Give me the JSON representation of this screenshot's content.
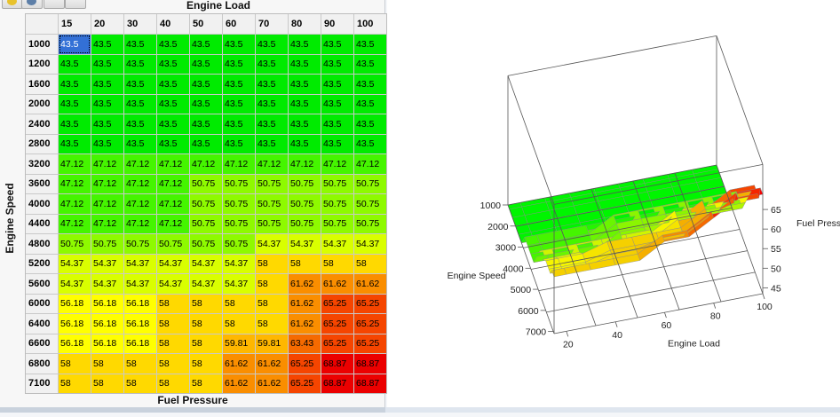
{
  "table": {
    "x_axis_title": "Engine Load",
    "y_axis_title": "Engine Speed",
    "caption": "Fuel Pressure",
    "columns": [
      "15",
      "20",
      "30",
      "40",
      "50",
      "60",
      "70",
      "80",
      "90",
      "100"
    ],
    "rows": [
      {
        "label": "1000",
        "cells": [
          "43.5",
          "43.5",
          "43.5",
          "43.5",
          "43.5",
          "43.5",
          "43.5",
          "43.5",
          "43.5",
          "43.5"
        ]
      },
      {
        "label": "1200",
        "cells": [
          "43.5",
          "43.5",
          "43.5",
          "43.5",
          "43.5",
          "43.5",
          "43.5",
          "43.5",
          "43.5",
          "43.5"
        ]
      },
      {
        "label": "1600",
        "cells": [
          "43.5",
          "43.5",
          "43.5",
          "43.5",
          "43.5",
          "43.5",
          "43.5",
          "43.5",
          "43.5",
          "43.5"
        ]
      },
      {
        "label": "2000",
        "cells": [
          "43.5",
          "43.5",
          "43.5",
          "43.5",
          "43.5",
          "43.5",
          "43.5",
          "43.5",
          "43.5",
          "43.5"
        ]
      },
      {
        "label": "2400",
        "cells": [
          "43.5",
          "43.5",
          "43.5",
          "43.5",
          "43.5",
          "43.5",
          "43.5",
          "43.5",
          "43.5",
          "43.5"
        ]
      },
      {
        "label": "2800",
        "cells": [
          "43.5",
          "43.5",
          "43.5",
          "43.5",
          "43.5",
          "43.5",
          "43.5",
          "43.5",
          "43.5",
          "43.5"
        ]
      },
      {
        "label": "3200",
        "cells": [
          "47.12",
          "47.12",
          "47.12",
          "47.12",
          "47.12",
          "47.12",
          "47.12",
          "47.12",
          "47.12",
          "47.12"
        ]
      },
      {
        "label": "3600",
        "cells": [
          "47.12",
          "47.12",
          "47.12",
          "47.12",
          "50.75",
          "50.75",
          "50.75",
          "50.75",
          "50.75",
          "50.75"
        ]
      },
      {
        "label": "4000",
        "cells": [
          "47.12",
          "47.12",
          "47.12",
          "47.12",
          "50.75",
          "50.75",
          "50.75",
          "50.75",
          "50.75",
          "50.75"
        ]
      },
      {
        "label": "4400",
        "cells": [
          "47.12",
          "47.12",
          "47.12",
          "47.12",
          "50.75",
          "50.75",
          "50.75",
          "50.75",
          "50.75",
          "50.75"
        ]
      },
      {
        "label": "4800",
        "cells": [
          "50.75",
          "50.75",
          "50.75",
          "50.75",
          "50.75",
          "50.75",
          "54.37",
          "54.37",
          "54.37",
          "54.37"
        ]
      },
      {
        "label": "5200",
        "cells": [
          "54.37",
          "54.37",
          "54.37",
          "54.37",
          "54.37",
          "54.37",
          "58",
          "58",
          "58",
          "58"
        ]
      },
      {
        "label": "5600",
        "cells": [
          "54.37",
          "54.37",
          "54.37",
          "54.37",
          "54.37",
          "54.37",
          "58",
          "61.62",
          "61.62",
          "61.62"
        ]
      },
      {
        "label": "6000",
        "cells": [
          "56.18",
          "56.18",
          "56.18",
          "58",
          "58",
          "58",
          "58",
          "61.62",
          "65.25",
          "65.25"
        ]
      },
      {
        "label": "6400",
        "cells": [
          "56.18",
          "56.18",
          "56.18",
          "58",
          "58",
          "58",
          "58",
          "61.62",
          "65.25",
          "65.25"
        ]
      },
      {
        "label": "6600",
        "cells": [
          "56.18",
          "56.18",
          "56.18",
          "58",
          "58",
          "59.81",
          "59.81",
          "63.43",
          "65.25",
          "65.25"
        ]
      },
      {
        "label": "6800",
        "cells": [
          "58",
          "58",
          "58",
          "58",
          "58",
          "61.62",
          "61.62",
          "65.25",
          "68.87",
          "68.87"
        ]
      },
      {
        "label": "7100",
        "cells": [
          "58",
          "58",
          "58",
          "58",
          "58",
          "61.62",
          "61.62",
          "65.25",
          "68.87",
          "68.87"
        ]
      }
    ],
    "selected_cell": {
      "row": 0,
      "col": 0
    }
  },
  "chart_data": {
    "type": "surface3d",
    "x_axis": {
      "label": "Engine Load",
      "ticks": [
        "20",
        "40",
        "60",
        "80",
        "100"
      ]
    },
    "y_axis": {
      "label": "Engine Speed",
      "ticks": [
        "1000",
        "2000",
        "3000",
        "4000",
        "5000",
        "6000",
        "7000"
      ]
    },
    "z_axis": {
      "label": "Fuel Pressure",
      "ticks": [
        "45",
        "50",
        "55",
        "60",
        "65"
      ]
    },
    "zlim": [
      43.5,
      68.87
    ]
  },
  "colors": {
    "low": "#1ee01e",
    "high": "#ff1500",
    "selected": "#3370d6"
  }
}
